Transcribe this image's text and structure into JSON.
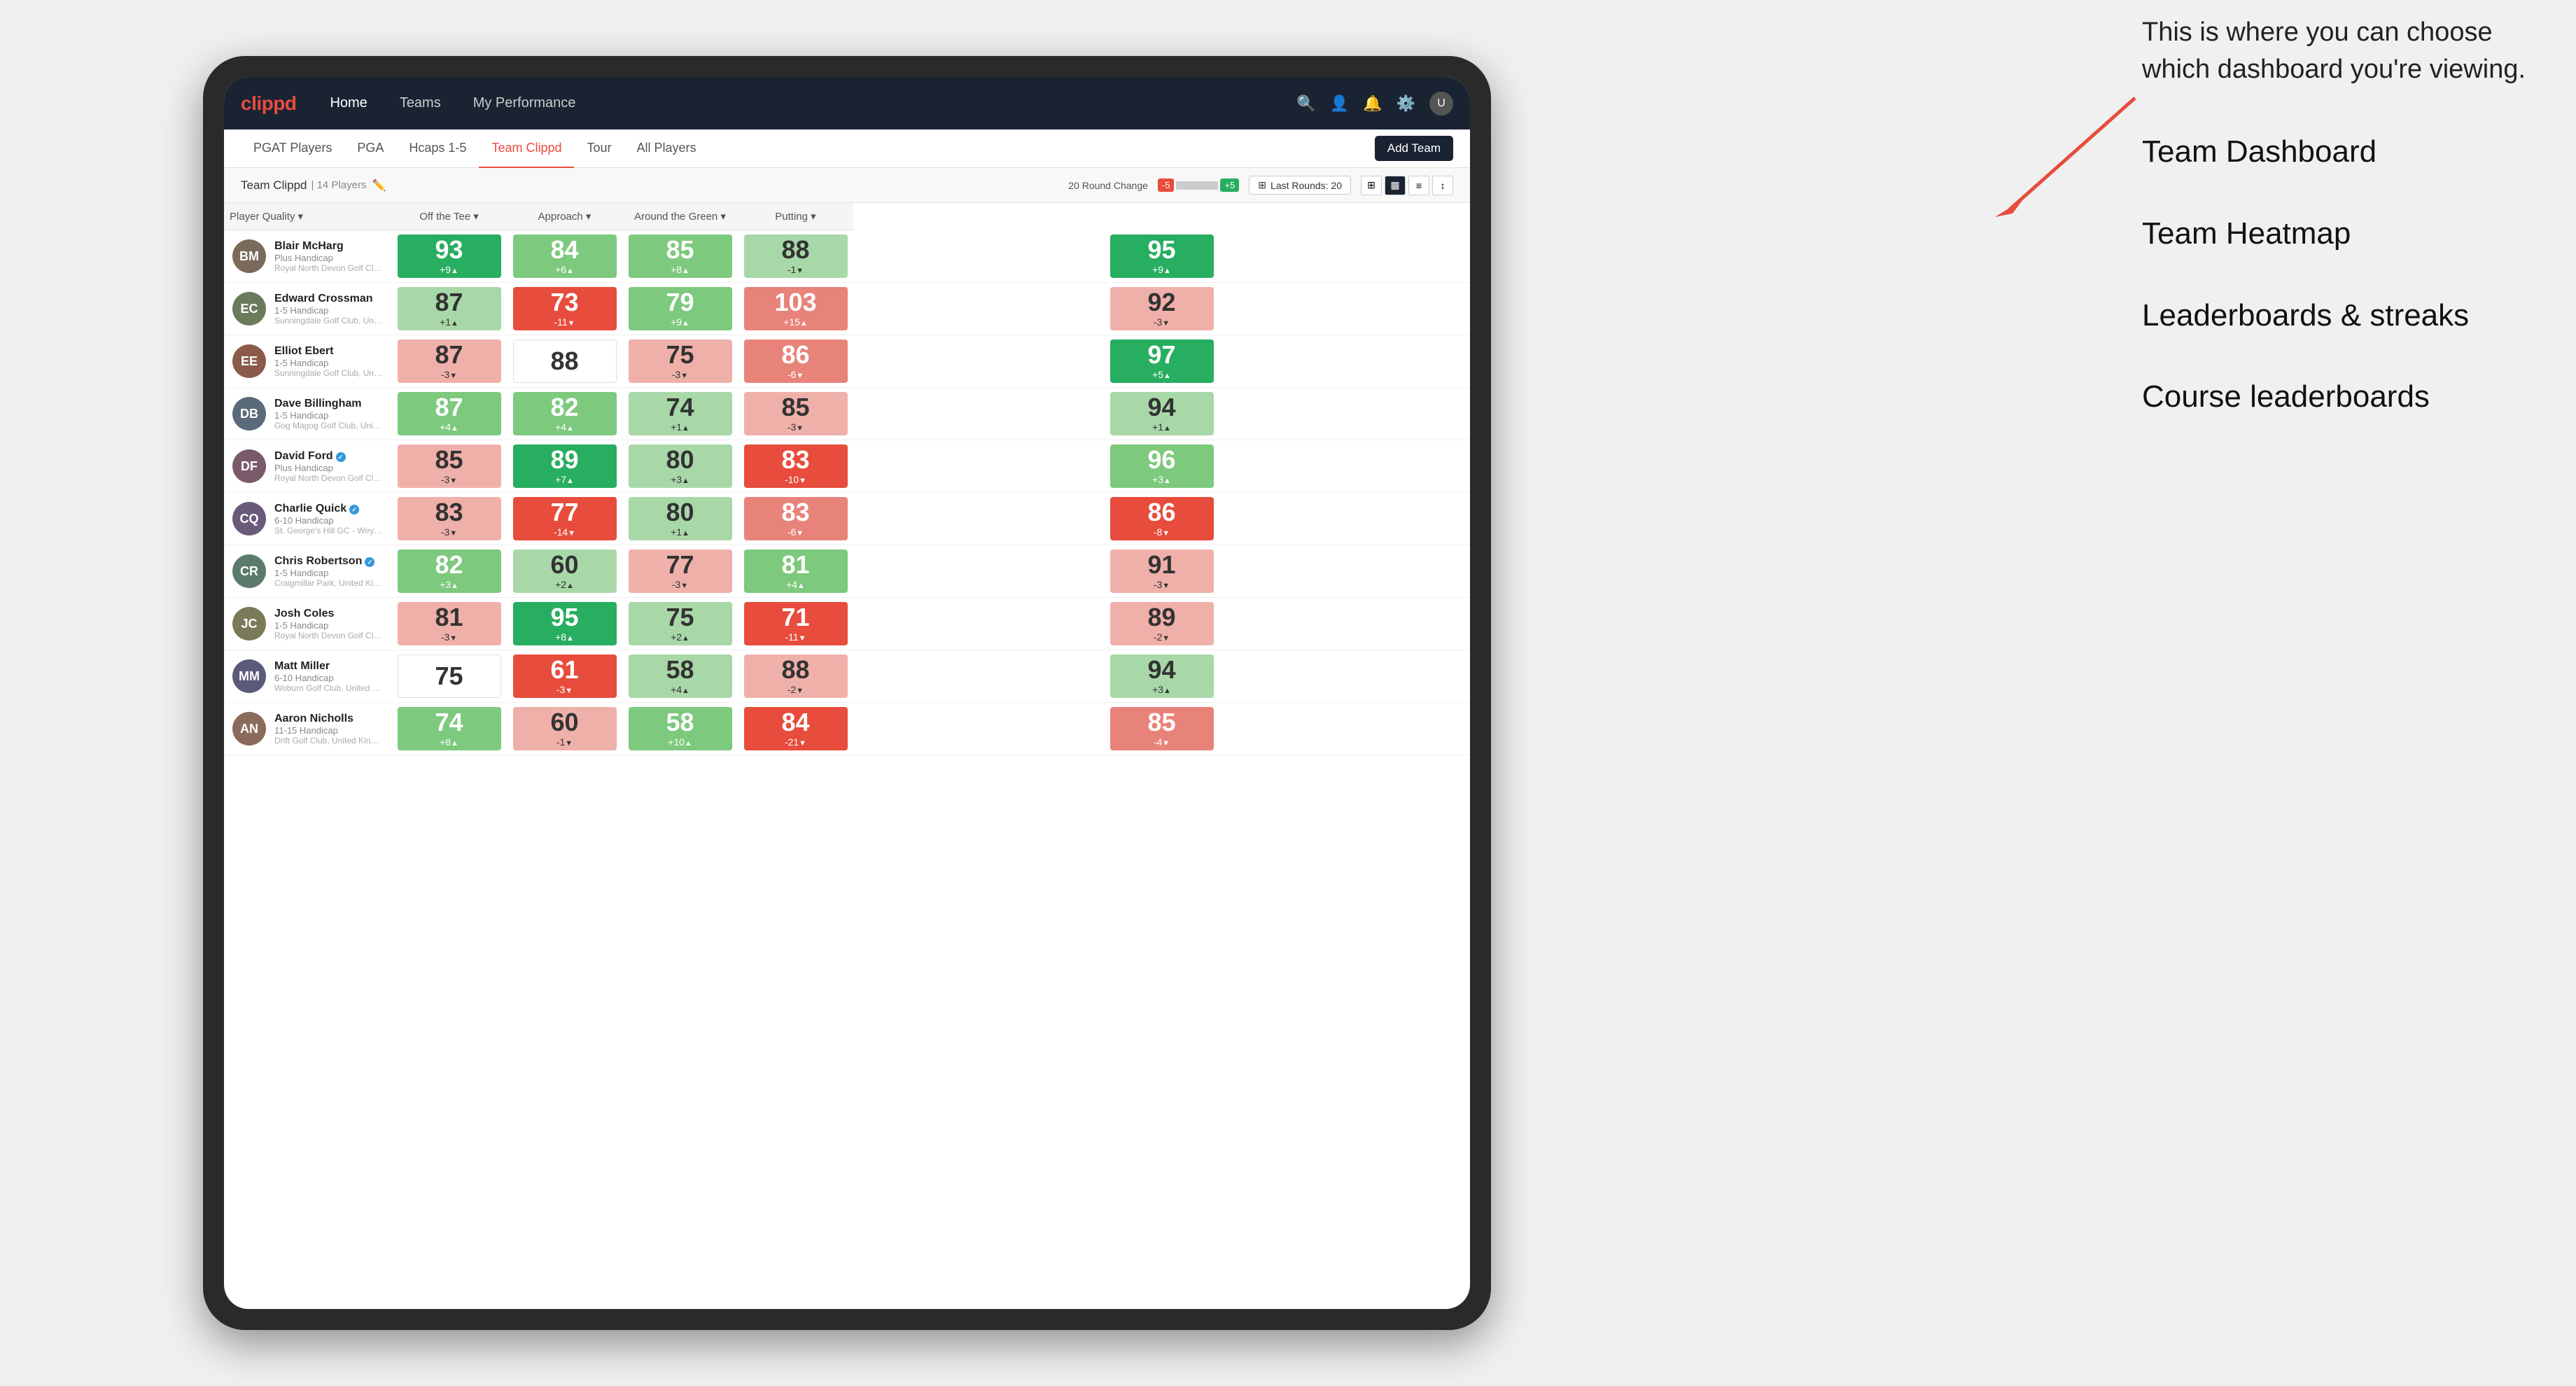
{
  "annotation": {
    "description": "This is where you can choose which dashboard you're viewing.",
    "items": [
      "Team Dashboard",
      "Team Heatmap",
      "Leaderboards & streaks",
      "Course leaderboards"
    ]
  },
  "nav": {
    "logo": "clippd",
    "links": [
      "Home",
      "Teams",
      "My Performance"
    ],
    "active_link": "My Performance"
  },
  "sub_nav": {
    "links": [
      "PGAT Players",
      "PGA",
      "Hcaps 1-5",
      "Team Clippd",
      "Tour",
      "All Players"
    ],
    "active_link": "Team Clippd",
    "add_team_label": "Add Team"
  },
  "team_bar": {
    "name": "Team Clippd",
    "separator": "|",
    "player_count": "14 Players",
    "round_change_label": "20 Round Change",
    "scale_neg": "-5",
    "scale_pos": "+5",
    "last_rounds_label": "Last Rounds:",
    "last_rounds_value": "20"
  },
  "table": {
    "headers": {
      "player": "Player Quality",
      "off_tee": "Off the Tee",
      "approach": "Approach",
      "around_green": "Around the Green",
      "putting": "Putting"
    },
    "rows": [
      {
        "name": "Blair McHarg",
        "initials": "BM",
        "handicap": "Plus Handicap",
        "club": "Royal North Devon Golf Club, United Kingdom",
        "avatar_color": "#7a6a5a",
        "scores": {
          "quality": {
            "value": 93,
            "change": "+9",
            "trend": "up",
            "bg": "bg-green-dark"
          },
          "off_tee": {
            "value": 84,
            "change": "+6",
            "trend": "up",
            "bg": "bg-green-light"
          },
          "approach": {
            "value": 85,
            "change": "+8",
            "trend": "up",
            "bg": "bg-green-light"
          },
          "around_green": {
            "value": 88,
            "change": "-1",
            "trend": "down",
            "bg": "bg-green-pale"
          },
          "putting": {
            "value": 95,
            "change": "+9",
            "trend": "up",
            "bg": "bg-green-dark"
          }
        }
      },
      {
        "name": "Edward Crossman",
        "initials": "EC",
        "handicap": "1-5 Handicap",
        "club": "Sunningdale Golf Club, United Kingdom",
        "avatar_color": "#6a7a5a",
        "scores": {
          "quality": {
            "value": 87,
            "change": "+1",
            "trend": "up",
            "bg": "bg-green-pale"
          },
          "off_tee": {
            "value": 73,
            "change": "-11",
            "trend": "down",
            "bg": "bg-red-dark"
          },
          "approach": {
            "value": 79,
            "change": "+9",
            "trend": "up",
            "bg": "bg-green-light"
          },
          "around_green": {
            "value": 103,
            "change": "+15",
            "trend": "up",
            "bg": "bg-red-light"
          },
          "putting": {
            "value": 92,
            "change": "-3",
            "trend": "down",
            "bg": "bg-red-pale"
          }
        }
      },
      {
        "name": "Elliot Ebert",
        "initials": "EE",
        "handicap": "1-5 Handicap",
        "club": "Sunningdale Golf Club, United Kingdom",
        "avatar_color": "#8a5a4a",
        "scores": {
          "quality": {
            "value": 87,
            "change": "-3",
            "trend": "down",
            "bg": "bg-red-pale"
          },
          "off_tee": {
            "value": 88,
            "change": "",
            "trend": "",
            "bg": "bg-white"
          },
          "approach": {
            "value": 75,
            "change": "-3",
            "trend": "down",
            "bg": "bg-red-pale"
          },
          "around_green": {
            "value": 86,
            "change": "-6",
            "trend": "down",
            "bg": "bg-red-light"
          },
          "putting": {
            "value": 97,
            "change": "+5",
            "trend": "up",
            "bg": "bg-green-dark"
          }
        }
      },
      {
        "name": "Dave Billingham",
        "initials": "DB",
        "handicap": "1-5 Handicap",
        "club": "Gog Magog Golf Club, United Kingdom",
        "avatar_color": "#5a6a7a",
        "scores": {
          "quality": {
            "value": 87,
            "change": "+4",
            "trend": "up",
            "bg": "bg-green-light"
          },
          "off_tee": {
            "value": 82,
            "change": "+4",
            "trend": "up",
            "bg": "bg-green-light"
          },
          "approach": {
            "value": 74,
            "change": "+1",
            "trend": "up",
            "bg": "bg-green-pale"
          },
          "around_green": {
            "value": 85,
            "change": "-3",
            "trend": "down",
            "bg": "bg-red-pale"
          },
          "putting": {
            "value": 94,
            "change": "+1",
            "trend": "up",
            "bg": "bg-green-pale"
          }
        }
      },
      {
        "name": "David Ford",
        "initials": "DF",
        "handicap": "Plus Handicap",
        "club": "Royal North Devon Golf Club, United Kingdom",
        "avatar_color": "#7a5a6a",
        "verified": true,
        "scores": {
          "quality": {
            "value": 85,
            "change": "-3",
            "trend": "down",
            "bg": "bg-red-pale"
          },
          "off_tee": {
            "value": 89,
            "change": "+7",
            "trend": "up",
            "bg": "bg-green-dark"
          },
          "approach": {
            "value": 80,
            "change": "+3",
            "trend": "up",
            "bg": "bg-green-pale"
          },
          "around_green": {
            "value": 83,
            "change": "-10",
            "trend": "down",
            "bg": "bg-red-dark"
          },
          "putting": {
            "value": 96,
            "change": "+3",
            "trend": "up",
            "bg": "bg-green-light"
          }
        }
      },
      {
        "name": "Charlie Quick",
        "initials": "CQ",
        "handicap": "6-10 Handicap",
        "club": "St. George's Hill GC - Weybridge - Surrey, Uni...",
        "avatar_color": "#6a5a7a",
        "verified": true,
        "scores": {
          "quality": {
            "value": 83,
            "change": "-3",
            "trend": "down",
            "bg": "bg-red-pale"
          },
          "off_tee": {
            "value": 77,
            "change": "-14",
            "trend": "down",
            "bg": "bg-red-dark"
          },
          "approach": {
            "value": 80,
            "change": "+1",
            "trend": "up",
            "bg": "bg-green-pale"
          },
          "around_green": {
            "value": 83,
            "change": "-6",
            "trend": "down",
            "bg": "bg-red-light"
          },
          "putting": {
            "value": 86,
            "change": "-8",
            "trend": "down",
            "bg": "bg-red-dark"
          }
        }
      },
      {
        "name": "Chris Robertson",
        "initials": "CR",
        "handicap": "1-5 Handicap",
        "club": "Craigmillar Park, United Kingdom",
        "avatar_color": "#5a7a6a",
        "verified": true,
        "scores": {
          "quality": {
            "value": 82,
            "change": "+3",
            "trend": "up",
            "bg": "bg-green-light"
          },
          "off_tee": {
            "value": 60,
            "change": "+2",
            "trend": "up",
            "bg": "bg-green-pale"
          },
          "approach": {
            "value": 77,
            "change": "-3",
            "trend": "down",
            "bg": "bg-red-pale"
          },
          "around_green": {
            "value": 81,
            "change": "+4",
            "trend": "up",
            "bg": "bg-green-light"
          },
          "putting": {
            "value": 91,
            "change": "-3",
            "trend": "down",
            "bg": "bg-red-pale"
          }
        }
      },
      {
        "name": "Josh Coles",
        "initials": "JC",
        "handicap": "1-5 Handicap",
        "club": "Royal North Devon Golf Club, United Kingdom",
        "avatar_color": "#7a7a5a",
        "scores": {
          "quality": {
            "value": 81,
            "change": "-3",
            "trend": "down",
            "bg": "bg-red-pale"
          },
          "off_tee": {
            "value": 95,
            "change": "+8",
            "trend": "up",
            "bg": "bg-green-dark"
          },
          "approach": {
            "value": 75,
            "change": "+2",
            "trend": "up",
            "bg": "bg-green-pale"
          },
          "around_green": {
            "value": 71,
            "change": "-11",
            "trend": "down",
            "bg": "bg-red-dark"
          },
          "putting": {
            "value": 89,
            "change": "-2",
            "trend": "down",
            "bg": "bg-red-pale"
          }
        }
      },
      {
        "name": "Matt Miller",
        "initials": "MM",
        "handicap": "6-10 Handicap",
        "club": "Woburn Golf Club, United Kingdom",
        "avatar_color": "#5a5a7a",
        "scores": {
          "quality": {
            "value": 75,
            "change": "",
            "trend": "",
            "bg": "bg-white"
          },
          "off_tee": {
            "value": 61,
            "change": "-3",
            "trend": "down",
            "bg": "bg-red-dark"
          },
          "approach": {
            "value": 58,
            "change": "+4",
            "trend": "up",
            "bg": "bg-green-pale"
          },
          "around_green": {
            "value": 88,
            "change": "-2",
            "trend": "down",
            "bg": "bg-red-pale"
          },
          "putting": {
            "value": 94,
            "change": "+3",
            "trend": "up",
            "bg": "bg-green-pale"
          }
        }
      },
      {
        "name": "Aaron Nicholls",
        "initials": "AN",
        "handicap": "11-15 Handicap",
        "club": "Drift Golf Club, United Kingdom",
        "avatar_color": "#8a6a5a",
        "scores": {
          "quality": {
            "value": 74,
            "change": "+8",
            "trend": "up",
            "bg": "bg-green-light"
          },
          "off_tee": {
            "value": 60,
            "change": "-1",
            "trend": "down",
            "bg": "bg-red-pale"
          },
          "approach": {
            "value": 58,
            "change": "+10",
            "trend": "up",
            "bg": "bg-green-light"
          },
          "around_green": {
            "value": 84,
            "change": "-21",
            "trend": "down",
            "bg": "bg-red-dark"
          },
          "putting": {
            "value": 85,
            "change": "-4",
            "trend": "down",
            "bg": "bg-red-light"
          }
        }
      }
    ]
  }
}
